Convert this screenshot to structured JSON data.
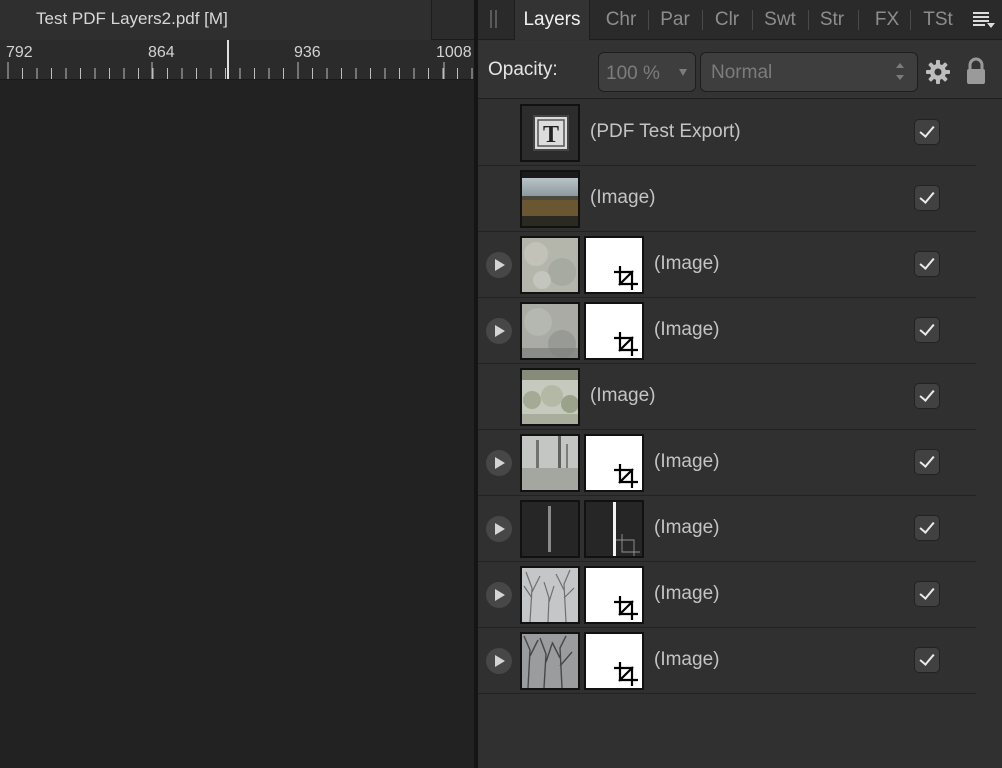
{
  "document": {
    "title": "Test PDF Layers2.pdf [M]",
    "ruler_labels": [
      "792",
      "864",
      "936",
      "1008"
    ]
  },
  "panel": {
    "tabs": [
      {
        "label": "Layers",
        "active": true
      },
      {
        "label": "Chr",
        "active": false
      },
      {
        "label": "Par",
        "active": false
      },
      {
        "label": "Clr",
        "active": false
      },
      {
        "label": "Swt",
        "active": false
      },
      {
        "label": "Str",
        "active": false
      },
      {
        "label": "FX",
        "active": false
      },
      {
        "label": "TSt",
        "active": false
      }
    ],
    "opacity_label": "Opacity:",
    "opacity_value": "100 %",
    "blend_mode": "Normal",
    "icons": {
      "gear": "gear-icon",
      "lock": "lock-icon",
      "menu": "panel-menu-icon",
      "grip": "grip-icon"
    }
  },
  "layers": [
    {
      "name": "(PDF Test Export)",
      "kind": "text",
      "expandable": false,
      "has_mask": false,
      "visible": true
    },
    {
      "name": "(Image)",
      "kind": "landscape",
      "expandable": false,
      "has_mask": false,
      "visible": true
    },
    {
      "name": "(Image)",
      "kind": "texture-light",
      "expandable": true,
      "has_mask": true,
      "visible": true
    },
    {
      "name": "(Image)",
      "kind": "texture-grey",
      "expandable": true,
      "has_mask": true,
      "visible": true
    },
    {
      "name": "(Image)",
      "kind": "foliage",
      "expandable": false,
      "has_mask": false,
      "visible": true
    },
    {
      "name": "(Image)",
      "kind": "trees-field",
      "expandable": true,
      "has_mask": true,
      "visible": true
    },
    {
      "name": "(Image)",
      "kind": "dark-strip",
      "expandable": true,
      "has_mask": true,
      "mask_dark": true,
      "visible": true
    },
    {
      "name": "(Image)",
      "kind": "bare-trees",
      "expandable": true,
      "has_mask": true,
      "visible": true
    },
    {
      "name": "(Image)",
      "kind": "bare-trees-dark",
      "expandable": true,
      "has_mask": true,
      "visible": true
    }
  ],
  "colors": {
    "panel_bg": "#303030",
    "canvas_bg": "#232323",
    "active_tab_text": "#f0f0f0",
    "inactive_tab_text": "#8d8d8d"
  }
}
